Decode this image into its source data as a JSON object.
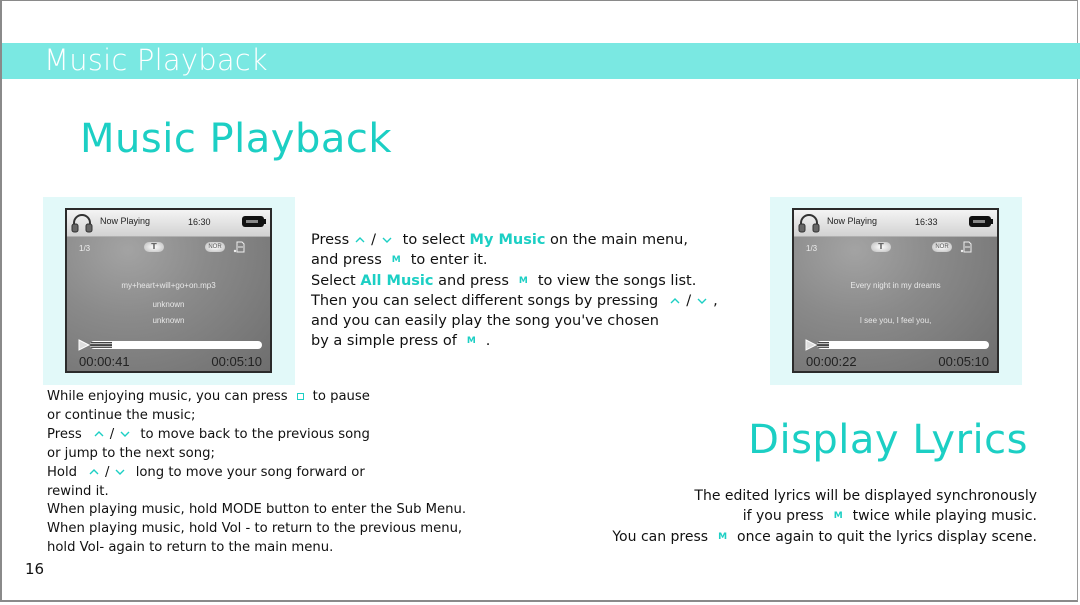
{
  "header": {
    "title": "Music Playback"
  },
  "main_title": "Music Playback",
  "accent_color": "#1CCFC4",
  "header_bar_color": "#7AE8E2",
  "device_screens": [
    {
      "status_label": "Now Playing",
      "clock": "16:30",
      "track_index": "1/3",
      "repeat_icon": "T",
      "eq_mode": "NOR",
      "lines": [
        "my+heart+will+go+on.mp3",
        "unknown",
        "unknown"
      ],
      "progress_fraction": 0.13,
      "elapsed": "00:00:41",
      "total": "00:05:10"
    },
    {
      "status_label": "Now Playing",
      "clock": "16:33",
      "track_index": "1/3",
      "repeat_icon": "T",
      "eq_mode": "NOR",
      "lines": [
        "Every night in my dreams",
        "I see you, I feel you,"
      ],
      "progress_fraction": 0.07,
      "elapsed": "00:00:22",
      "total": "00:05:10"
    }
  ],
  "instructions": {
    "l1_a": "Press",
    "l1_b": "to select",
    "l1_hl": "My Music",
    "l1_c": "on the main menu,",
    "l2_a": "and press",
    "l2_b": "to enter it.",
    "l3_a": "Select",
    "l3_hl": "All Music",
    "l3_b": "and press",
    "l3_c": "to view the songs list.",
    "l4_a": "Then you can select different songs by pressing",
    "l4_b": ",",
    "l5": "and you can easily play the song you've chosen",
    "l6_a": "by a simple press of",
    "l6_b": "."
  },
  "keys": {
    "m": "M",
    "slash": "/"
  },
  "left_notes": {
    "l1_a": "While enjoying music, you can press",
    "l1_b": "to pause",
    "l2": "or continue the music;",
    "l3_a": "Press",
    "l3_b": "to move back to the previous song",
    "l4": "or jump to the next song;",
    "l5_a": "Hold",
    "l5_b": "long to move your song forward or",
    "l6": "rewind it.",
    "l7": "When playing music, hold MODE button to enter the Sub Menu.",
    "l8": "When playing music, hold Vol - to return to the previous menu,",
    "l9": "hold Vol- again to return to the main menu."
  },
  "lyrics_section": {
    "title": "Display Lyrics",
    "l1": "The edited lyrics will be displayed synchronously",
    "l2_a": "if you press",
    "l2_b": "twice while playing music.",
    "l3_a": "You can press",
    "l3_b": "once again to quit the lyrics display scene."
  },
  "page_number": "16"
}
